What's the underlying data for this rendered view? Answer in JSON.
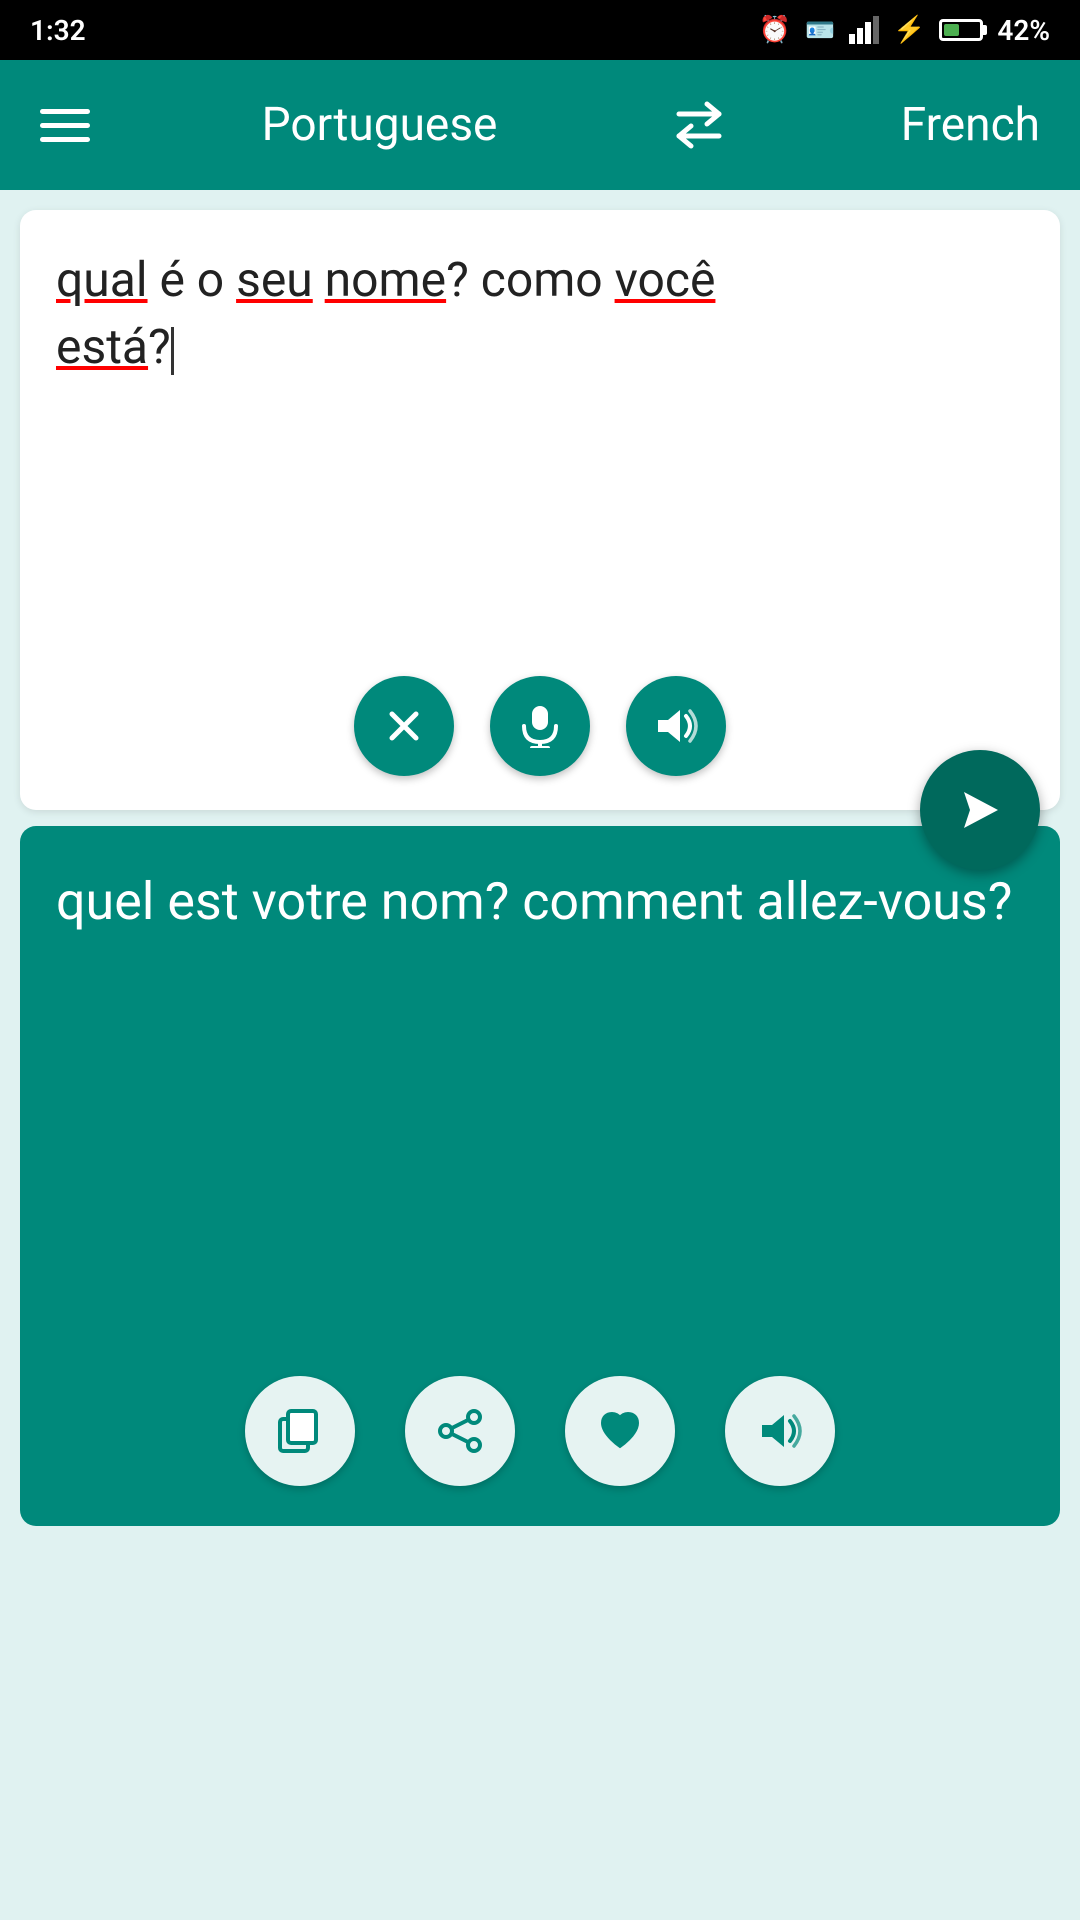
{
  "statusBar": {
    "time": "1:32",
    "battery": "42%"
  },
  "header": {
    "sourceLang": "Portuguese",
    "targetLang": "French",
    "swapLabel": "swap languages"
  },
  "sourcePanel": {
    "inputText": "qual é o seu nome? como você está?",
    "clearLabel": "clear",
    "micLabel": "microphone",
    "speakLabel": "speak source"
  },
  "targetPanel": {
    "translatedText": "quel est votre nom? comment allez-vous?",
    "copyLabel": "copy",
    "shareLabel": "share",
    "favoriteLabel": "favorite",
    "speakLabel": "speak translation"
  },
  "fab": {
    "translateLabel": "translate"
  }
}
